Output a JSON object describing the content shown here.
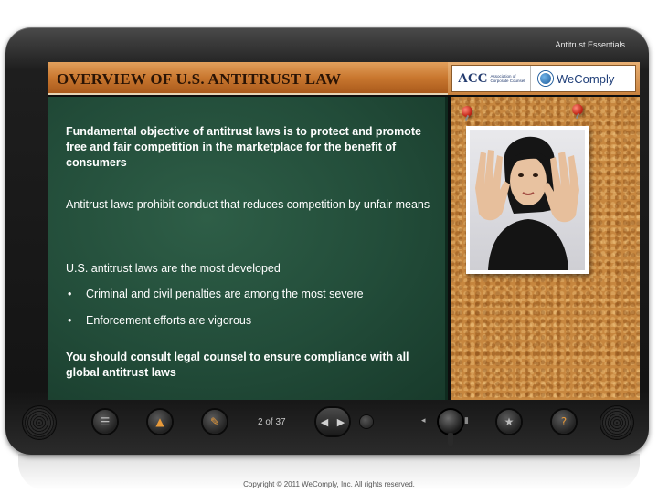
{
  "app": {
    "course_title": "Antitrust Essentials"
  },
  "header": {
    "page_title": "OVERVIEW OF U.S. ANTITRUST LAW",
    "logos": {
      "acc_mark": "ACC",
      "acc_text": "Association of Corporate Counsel",
      "wecomply_text": "WeComply"
    }
  },
  "content": {
    "intro": "Fundamental objective of antitrust laws is to protect and promote free and fair competition in the marketplace for the benefit of consumers",
    "prohibition": "Antitrust laws prohibit conduct that reduces competition by unfair means",
    "developed": "U.S. antitrust laws are the most developed",
    "bullets": [
      "Criminal and civil penalties are among the most severe",
      "Enforcement efforts are vigorous"
    ],
    "bullet_glyph": "•",
    "consult": "You should consult legal counsel to ensure compliance with all global antitrust laws"
  },
  "controls": {
    "page_counter": "2 of 37",
    "icons": [
      "menu-icon",
      "home-icon",
      "notes-icon",
      "prev-icon",
      "next-icon",
      "replay-icon",
      "volume-icon",
      "resources-icon",
      "help-icon"
    ]
  },
  "footer": {
    "copyright": "Copyright © 2011 WeComply, Inc.  All rights reserved."
  },
  "colors": {
    "chalkboard": "#224c39",
    "header_orange": "#c9772f",
    "cork": "#c7873f",
    "bezel": "#141414"
  }
}
